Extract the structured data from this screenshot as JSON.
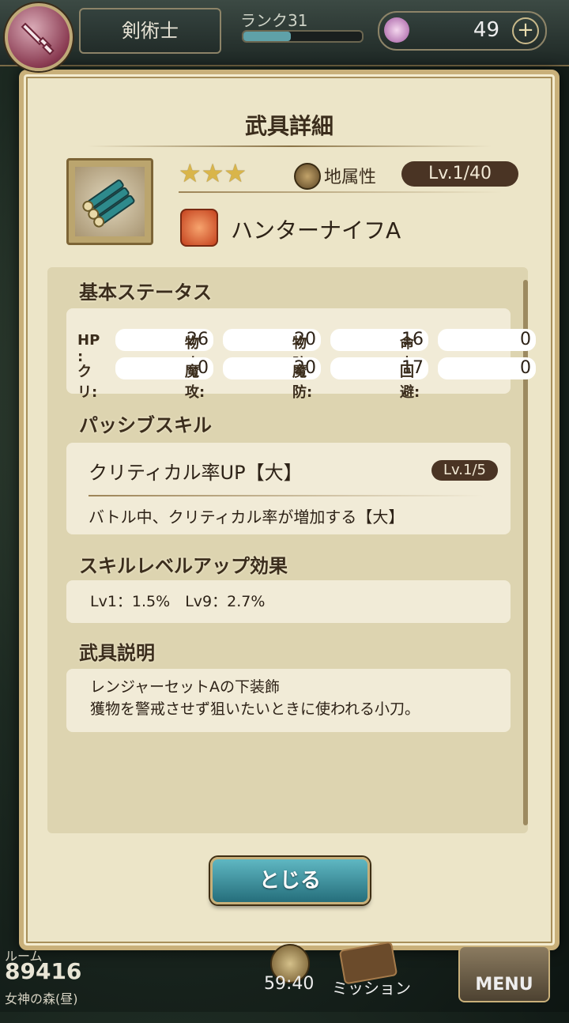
{
  "header": {
    "job_name": "剣術士",
    "rank_label": "ランク31",
    "rank_progress": 0.4,
    "gem_count": "49"
  },
  "dialog": {
    "title": "武具詳細",
    "stars": "★★★",
    "attribute_label": "地属性",
    "level": "Lv.1/40",
    "weapon_name": "ハンターナイフA",
    "basic_status_heading": "基本ステータス",
    "stats": [
      {
        "label": "HP :",
        "value": "26"
      },
      {
        "label": "物攻:",
        "value": "20"
      },
      {
        "label": "物防:",
        "value": "16"
      },
      {
        "label": "命中:",
        "value": "0"
      },
      {
        "label": "クリ:",
        "value": "0"
      },
      {
        "label": "魔攻:",
        "value": "20"
      },
      {
        "label": "魔防:",
        "value": "17"
      },
      {
        "label": "回避:",
        "value": "0"
      }
    ],
    "passive_heading": "パッシブスキル",
    "skill_name": "クリティカル率UP【大】",
    "skill_level": "Lv.1/5",
    "skill_description": "バトル中、クリティカル率が増加する【大】",
    "skill_levelup_heading": "スキルレベルアップ効果",
    "skill_levelup_text": "Lv1：1.5%　Lv9：2.7%",
    "description_heading": "武具説明",
    "description_lines": [
      "レンジャーセットAの下装飾",
      "獲物を警戒させず狙いたいときに使われる小刀。"
    ],
    "close_label": "とじる"
  },
  "footer": {
    "room_label": "ルーム",
    "room_number": "89416",
    "area_name": "女神の森(昼)",
    "timer": "59:40",
    "mission_label": "ミッション",
    "menu_label": "MENU"
  },
  "colors": {
    "accent": "#4a3424",
    "button": "#3a8f9a",
    "panel": "#ece5c8"
  }
}
